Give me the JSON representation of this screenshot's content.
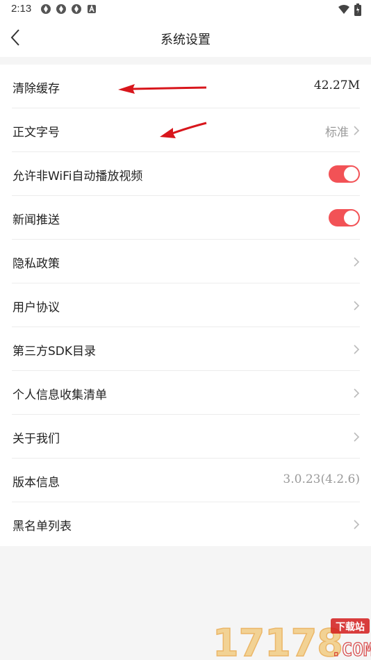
{
  "status_bar": {
    "time": "2:13",
    "icons": [
      "app-notification-icon",
      "app-notification-icon",
      "app-notification-icon",
      "a-notification-icon"
    ],
    "right_icons": [
      "wifi-icon",
      "battery-icon"
    ]
  },
  "header": {
    "title": "系统设置"
  },
  "settings": [
    {
      "label": "清除缓存",
      "value": "42.27M",
      "type": "value"
    },
    {
      "label": "正文字号",
      "value": "标准",
      "type": "value-chevron"
    },
    {
      "label": "允许非WiFi自动播放视频",
      "type": "toggle",
      "on": true
    },
    {
      "label": "新闻推送",
      "type": "toggle",
      "on": true
    },
    {
      "label": "隐私政策",
      "type": "chevron"
    },
    {
      "label": "用户协议",
      "type": "chevron"
    },
    {
      "label": "第三方SDK目录",
      "type": "chevron"
    },
    {
      "label": "个人信息收集清单",
      "type": "chevron"
    },
    {
      "label": "关于我们",
      "type": "chevron"
    },
    {
      "label": "版本信息",
      "value": "3.0.23(4.2.6)",
      "type": "value-muted"
    },
    {
      "label": "黑名单列表",
      "type": "chevron"
    }
  ],
  "watermark": {
    "number": "17178",
    "badge": "下载站",
    "domain": ".COM"
  },
  "colors": {
    "accent": "#f25256",
    "arrow": "#d8161c"
  }
}
